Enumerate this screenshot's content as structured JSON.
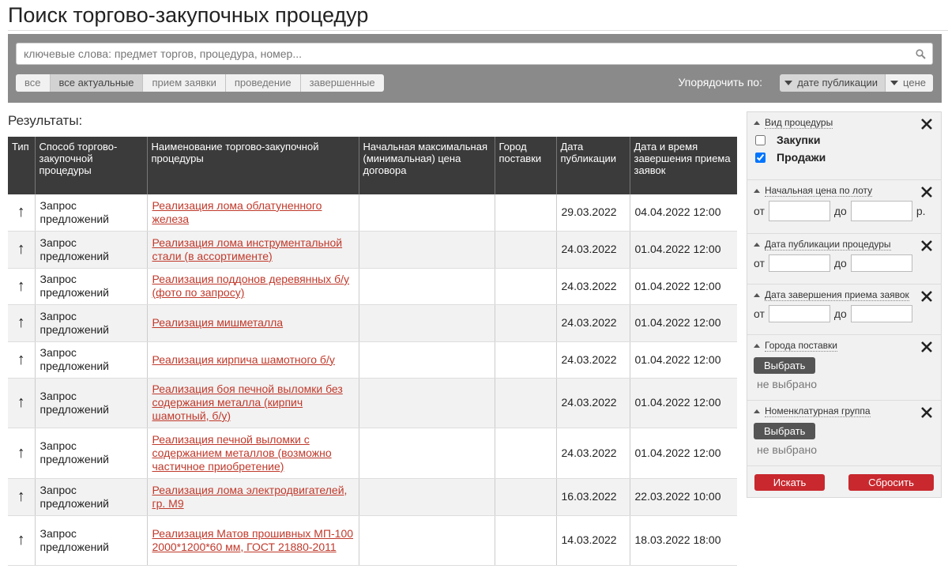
{
  "page": {
    "title": "Поиск торгово-закупочных процедур"
  },
  "search": {
    "placeholder": "ключевые слова: предмет торгов, процедура, номер..."
  },
  "filters": [
    {
      "label": "все",
      "active": false
    },
    {
      "label": "все актуальные",
      "active": true
    },
    {
      "label": "прием заявки",
      "active": false
    },
    {
      "label": "проведение",
      "active": false
    },
    {
      "label": "завершенные",
      "active": false
    }
  ],
  "sort": {
    "label": "Упорядочить по:",
    "options": [
      {
        "label": "дате публикации",
        "active": true
      },
      {
        "label": "цене",
        "active": false
      }
    ]
  },
  "results": {
    "label": "Результаты:",
    "columns": [
      "Тип",
      "Способ торгово-закупочной процедуры",
      "Наименование торгово-закупочной процедуры",
      "Начальная максимальная (минимальная) цена договора",
      "Город поставки",
      "Дата публикации",
      "Дата и время завершения приема заявок"
    ],
    "rows": [
      {
        "type_icon": "↑",
        "method": "Запрос предложений",
        "name": "Реализация лома облатуненного железа",
        "price": "",
        "city": "",
        "published": "29.03.2022",
        "deadline": "04.04.2022 12:00"
      },
      {
        "type_icon": "↑",
        "method": "Запрос предложений",
        "name": "Реализация лома инструментальной стали (в ассортименте)",
        "price": "",
        "city": "",
        "published": "24.03.2022",
        "deadline": "01.04.2022 12:00"
      },
      {
        "type_icon": "↑",
        "method": "Запрос предложений",
        "name": "Реализация поддонов деревянных б/у (фото по запросу)",
        "price": "",
        "city": "",
        "published": "24.03.2022",
        "deadline": "01.04.2022 12:00"
      },
      {
        "type_icon": "↑",
        "method": "Запрос предложений",
        "name": "Реализация мишметалла",
        "price": "",
        "city": "",
        "published": "24.03.2022",
        "deadline": "01.04.2022 12:00"
      },
      {
        "type_icon": "↑",
        "method": "Запрос предложений",
        "name": "Реализация кирпича шамотного б/у",
        "price": "",
        "city": "",
        "published": "24.03.2022",
        "deadline": "01.04.2022 12:00"
      },
      {
        "type_icon": "↑",
        "method": "Запрос предложений",
        "name": "Реализация боя печной выломки без содержания металла (кирпич шамотный, б/у)",
        "price": "",
        "city": "",
        "published": "24.03.2022",
        "deadline": "01.04.2022 12:00"
      },
      {
        "type_icon": "↑",
        "method": "Запрос предложений",
        "name": "Реализация печной выломки с содержанием металлов (возможно частичное приобретение)",
        "price": "",
        "city": "",
        "published": "24.03.2022",
        "deadline": "01.04.2022 12:00"
      },
      {
        "type_icon": "↑",
        "method": "Запрос предложений",
        "name": "Реализация лома электродвигателей, гр. М9",
        "price": "",
        "city": "",
        "published": "16.03.2022",
        "deadline": "22.03.2022 10:00"
      },
      {
        "type_icon": "↑",
        "method": "Запрос предложений",
        "name": "Реализация Матов прошивных МП-100 2000*1200*60 мм, ГОСТ 21880-2011",
        "price": "",
        "city": "",
        "published": "14.03.2022",
        "deadline": "18.03.2022 18:00"
      }
    ]
  },
  "sidebar": {
    "procedure_type": {
      "title": "Вид процедуры",
      "options": [
        {
          "label": "Закупки",
          "checked": false
        },
        {
          "label": "Продажи",
          "checked": true
        }
      ]
    },
    "start_price": {
      "title": "Начальная цена по лоту",
      "from": "от",
      "to": "до",
      "unit": "р."
    },
    "publish_date": {
      "title": "Дата публикации процедуры",
      "from": "от",
      "to": "до"
    },
    "deadline_date": {
      "title": "Дата завершения приема заявок",
      "from": "от",
      "to": "до"
    },
    "cities": {
      "title": "Города поставки",
      "button": "Выбрать",
      "value": "не выбрано"
    },
    "nomenclature": {
      "title": "Номенклатурная группа",
      "button": "Выбрать",
      "value": "не выбрано"
    },
    "search_button": "Искать",
    "reset_button": "Сбросить"
  }
}
